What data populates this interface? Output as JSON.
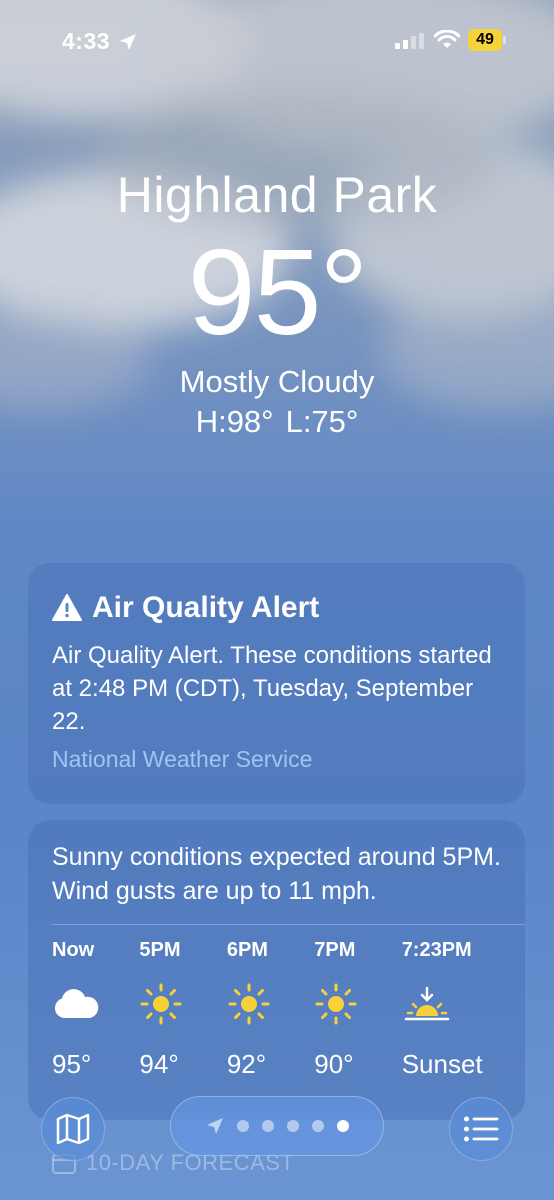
{
  "status_bar": {
    "time": "4:33",
    "battery": "49",
    "battery_color": "#f5d33b",
    "icons": [
      "location-arrow-icon",
      "signal-icon",
      "wifi-icon",
      "battery-icon"
    ]
  },
  "weather": {
    "city": "Highland Park",
    "temperature": "95°",
    "condition": "Mostly Cloudy",
    "high": "H:98°",
    "low": "L:75°"
  },
  "alert": {
    "title": "Air Quality Alert",
    "body": "Air Quality Alert. These conditions started at 2:48 PM (CDT), Tuesday, September 22.",
    "source": "National Weather Service",
    "icon": "warning-triangle-icon"
  },
  "hourly": {
    "summary": "Sunny conditions expected around 5PM. Wind gusts are up to 11 mph.",
    "hours": [
      {
        "label": "Now",
        "icon": "cloud-icon",
        "temp": "95°"
      },
      {
        "label": "5PM",
        "icon": "sun-icon",
        "temp": "94°"
      },
      {
        "label": "6PM",
        "icon": "sun-icon",
        "temp": "92°"
      },
      {
        "label": "7PM",
        "icon": "sun-icon",
        "temp": "90°"
      },
      {
        "label": "7:23PM",
        "icon": "sunset-icon",
        "temp": "Sunset"
      }
    ]
  },
  "forecast_peek": {
    "label": "10-DAY FORECAST",
    "icon": "calendar-icon"
  },
  "bottom_bar": {
    "map_icon": "map-icon",
    "list_icon": "list-icon",
    "pages": 5,
    "active_page": 5
  },
  "colors": {
    "sun": "#f7d13a",
    "alert_source": "#9fc6f2"
  }
}
